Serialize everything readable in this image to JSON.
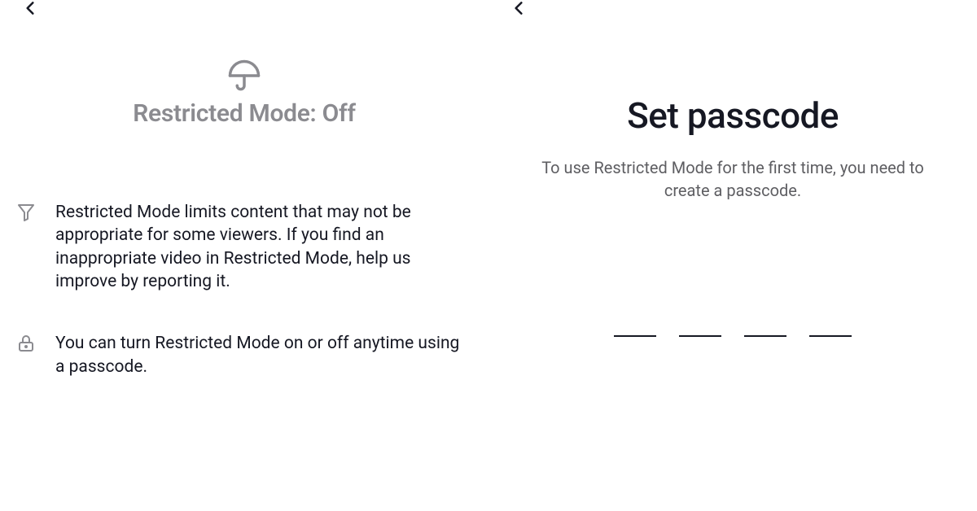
{
  "left": {
    "title": "Restricted Mode: Off",
    "items": [
      {
        "text": "Restricted Mode limits content that may not be appropriate for some viewers. If you find an inappropriate video in Restricted Mode, help us improve by reporting it."
      },
      {
        "text": "You can turn Restricted Mode on or off anytime using a passcode."
      }
    ]
  },
  "right": {
    "title": "Set passcode",
    "subtitle": "To use Restricted Mode for the first time, you need to create a passcode."
  }
}
